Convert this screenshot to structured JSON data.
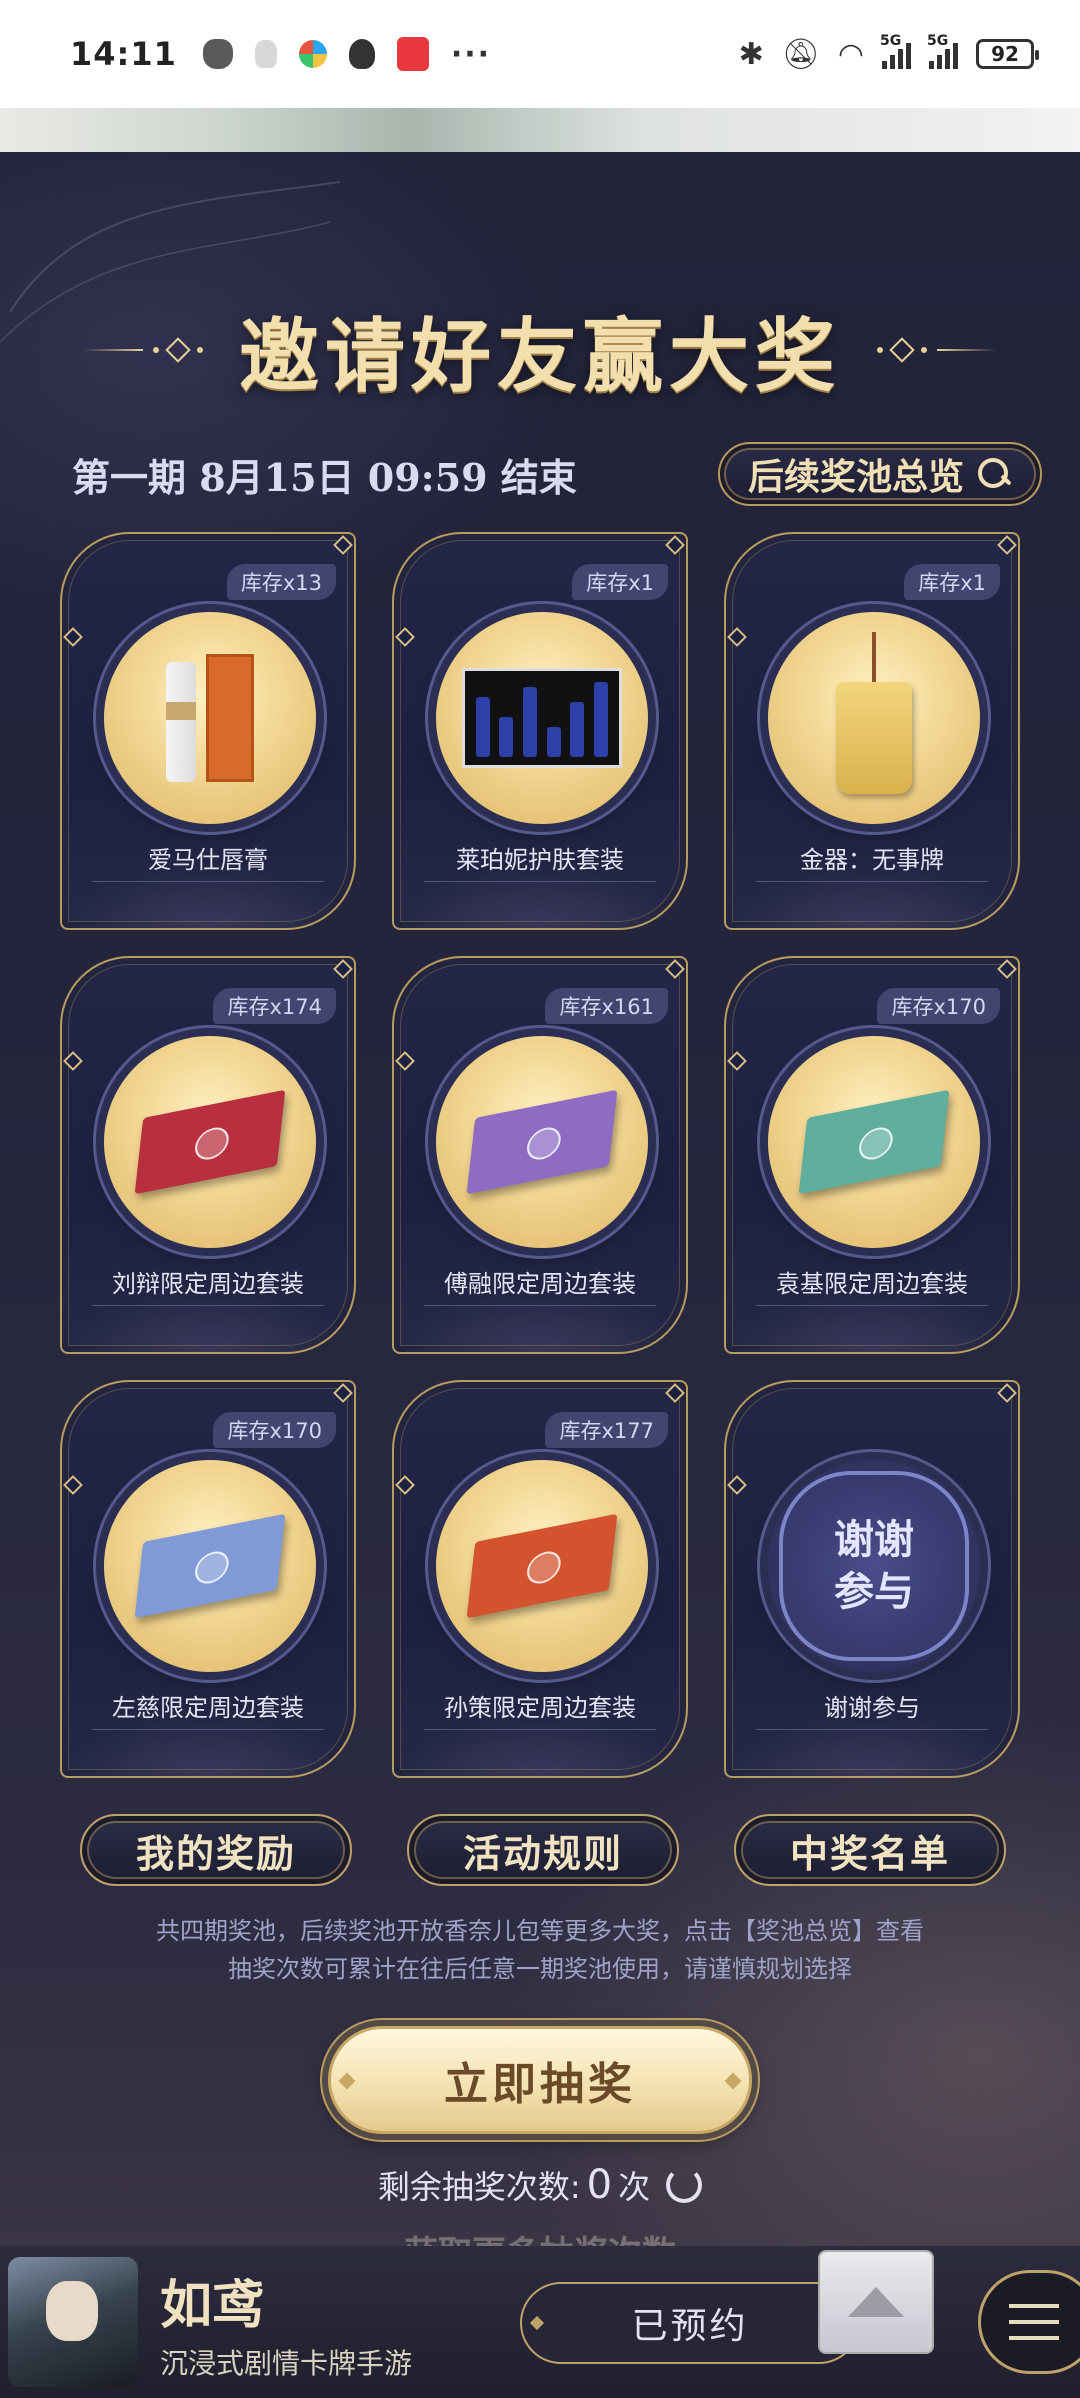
{
  "status_bar": {
    "time": "14:11",
    "battery": "92",
    "network_1": "5G",
    "network_2": "5G"
  },
  "header": {
    "title": "邀请好友赢大奖",
    "period_text": "第一期 8月15日 09:59 结束",
    "pool_overview_label": "后续奖池总览"
  },
  "prizes": [
    {
      "stock": "库存x13",
      "name": "爱马仕唇膏",
      "visual": "lipstick"
    },
    {
      "stock": "库存x1",
      "name": "莱珀妮护肤套装",
      "visual": "skincare"
    },
    {
      "stock": "库存x1",
      "name": "金器：无事牌",
      "visual": "plaque"
    },
    {
      "stock": "库存x174",
      "name": "刘辩限定周边套装",
      "visual": "envelope",
      "color": "#b8303f"
    },
    {
      "stock": "库存x161",
      "name": "傅融限定周边套装",
      "visual": "envelope",
      "color": "#8e6cc4"
    },
    {
      "stock": "库存x170",
      "name": "袁基限定周边套装",
      "visual": "envelope",
      "color": "#5fae9e"
    },
    {
      "stock": "库存x170",
      "name": "左慈限定周边套装",
      "visual": "envelope",
      "color": "#7f9ad6"
    },
    {
      "stock": "库存x177",
      "name": "孙策限定周边套装",
      "visual": "envelope",
      "color": "#d2532e"
    },
    {
      "stock": "",
      "name": "谢谢参与",
      "visual": "thanks",
      "badge_line1": "谢谢",
      "badge_line2": "参与"
    }
  ],
  "actions": {
    "my_rewards": "我的奖励",
    "rules": "活动规则",
    "winners": "中奖名单"
  },
  "notes": {
    "line1": "共四期奖池，后续奖池开放香奈儿包等更多大奖，点击【奖池总览】查看",
    "line2": "抽奖次数可累计在往后任意一期奖池使用，请谨慎规划选择"
  },
  "draw": {
    "button_label": "立即抽奖",
    "remaining_label": "剩余抽奖次数:",
    "remaining_count": "0",
    "remaining_unit": "次",
    "more_tip": "获取更多抽奖次数"
  },
  "bottom_bar": {
    "game_name": "如鸢",
    "game_subtitle": "沉浸式剧情卡牌手游",
    "reserved_label": "已预约"
  },
  "colors": {
    "accent_gold": "#b89b5f",
    "background": "#222339"
  }
}
